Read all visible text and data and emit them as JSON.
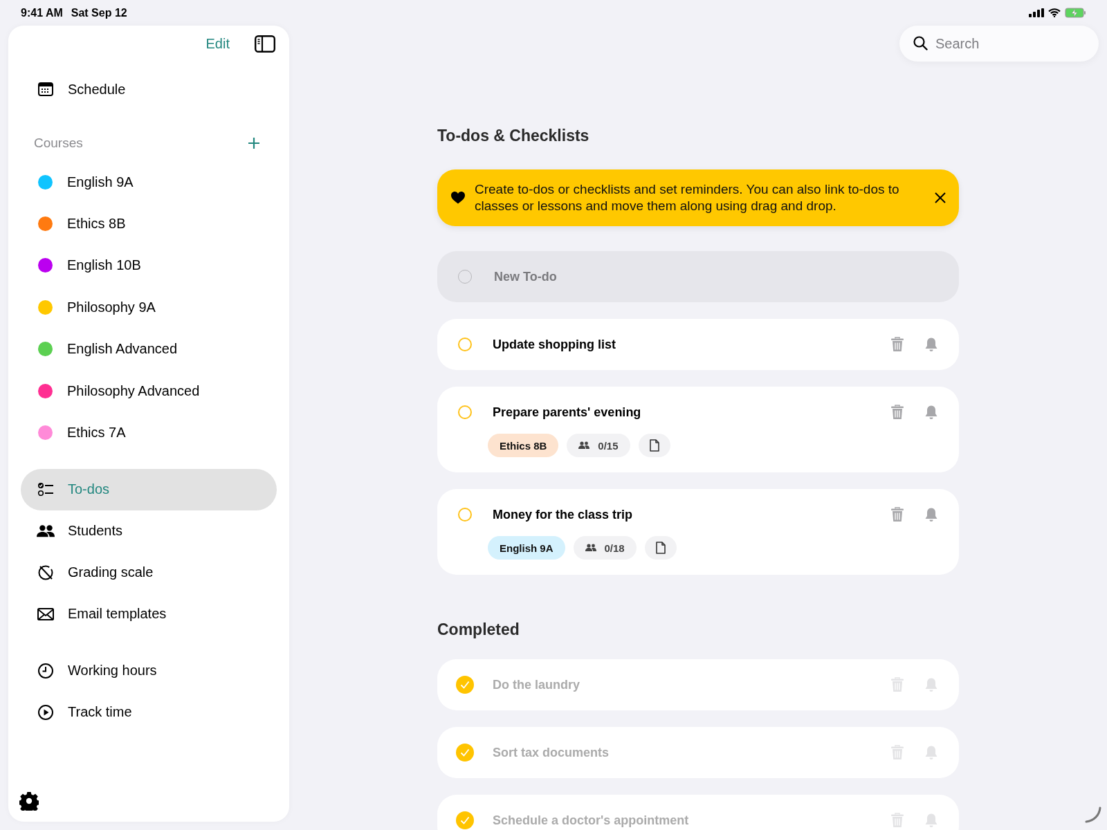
{
  "status_bar": {
    "time": "9:41 AM",
    "date": "Sat Sep 12"
  },
  "sidebar": {
    "edit": "Edit",
    "top_items": [
      {
        "label": "Schedule"
      }
    ],
    "courses_title": "Courses",
    "courses": [
      {
        "name": "English 9A",
        "color": "#10c4ff"
      },
      {
        "name": "Ethics 8B",
        "color": "#ff7a10"
      },
      {
        "name": "English 10B",
        "color": "#bb00f0"
      },
      {
        "name": "Philosophy 9A",
        "color": "#ffc800"
      },
      {
        "name": "English Advanced",
        "color": "#5cd052"
      },
      {
        "name": "Philosophy Advanced",
        "color": "#ff2f92"
      },
      {
        "name": "Ethics 7A",
        "color": "#ff8ad8"
      }
    ],
    "nav_items": [
      {
        "label": "To-dos",
        "selected": true
      },
      {
        "label": "Students",
        "selected": false
      },
      {
        "label": "Grading scale",
        "selected": false
      },
      {
        "label": "Email templates",
        "selected": false
      }
    ],
    "tool_items": [
      {
        "label": "Working hours"
      },
      {
        "label": "Track time"
      }
    ]
  },
  "search": {
    "placeholder": "Search"
  },
  "main": {
    "title": "To-dos & Checklists",
    "banner": "Create to-dos or checklists and set reminders. You can also link to-dos to classes or lessons and move them along using drag and drop.",
    "new_todo": {
      "placeholder": "New To-do"
    },
    "todos": [
      {
        "title": "Update shopping list",
        "checked": false
      },
      {
        "title": "Prepare parents' evening",
        "checked": false,
        "course": {
          "name": "Ethics 8B",
          "color": "#fde3cf"
        },
        "students": "0/15"
      },
      {
        "title": "Money for the class trip",
        "checked": false,
        "course": {
          "name": "English 9A",
          "color": "#d4f1fd"
        },
        "students": "0/18"
      }
    ],
    "completed_title": "Completed",
    "completed": [
      {
        "title": "Do the laundry",
        "checked": true
      },
      {
        "title": "Sort tax documents",
        "checked": true
      },
      {
        "title": "Schedule a doctor's appointment",
        "checked": true
      }
    ]
  }
}
